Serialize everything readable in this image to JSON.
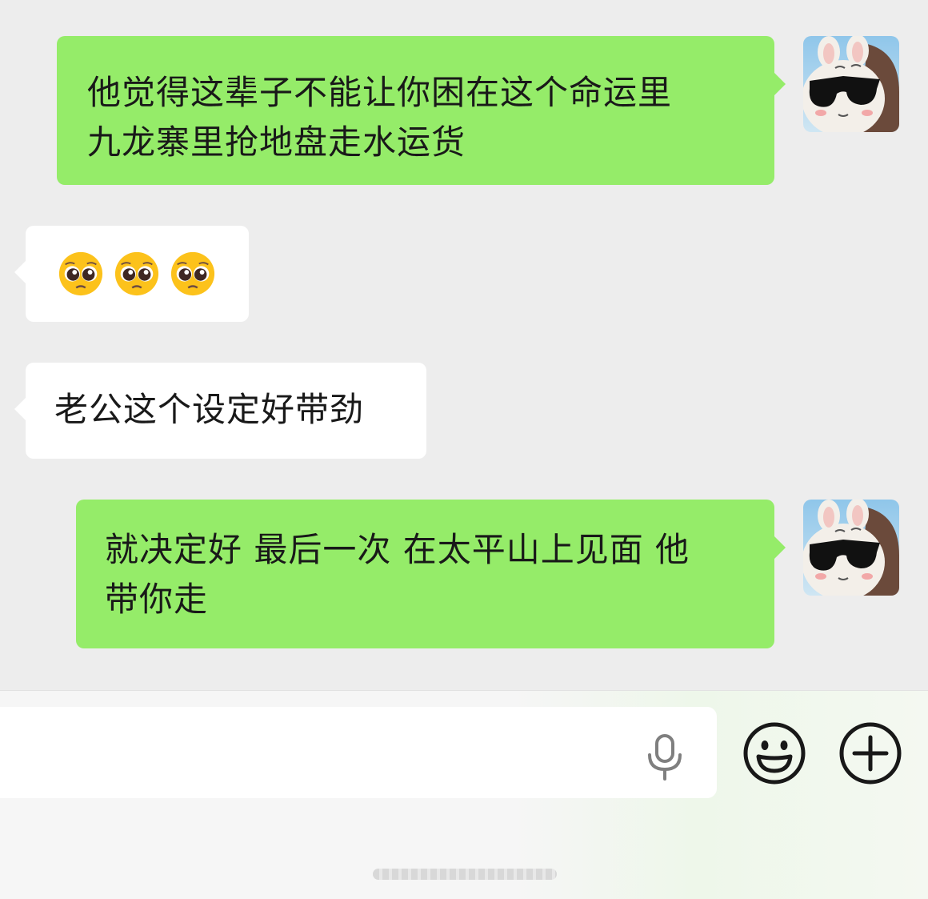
{
  "messages": [
    {
      "side": "out",
      "text": "他觉得这辈子不能让你困在这个命运里\n九龙寨里抢地盘走水运货"
    },
    {
      "side": "in",
      "emoji": [
        "pleading-face",
        "pleading-face",
        "pleading-face"
      ]
    },
    {
      "side": "in",
      "text": "老公这个设定好带劲"
    },
    {
      "side": "out",
      "text": "就决定好 最后一次 在太平山上见面 他\n带你走"
    }
  ],
  "input": {
    "value": "",
    "placeholder": ""
  },
  "icons": {
    "voice": "microphone-icon",
    "emoji": "smiley-icon",
    "more": "plus-icon"
  },
  "colors": {
    "outgoing_bubble": "#95ec69",
    "incoming_bubble": "#ffffff",
    "background": "#ededed"
  }
}
